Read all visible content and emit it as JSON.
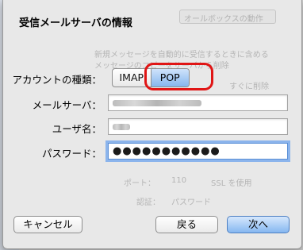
{
  "dialog": {
    "title": "受信メールサーバの情報",
    "account_type": {
      "label": "アカウントの種類：",
      "options": [
        "IMAP",
        "POP"
      ],
      "selected": "POP"
    },
    "mail_server": {
      "label": "メールサーバ："
    },
    "username": {
      "label": "ユーザ名："
    },
    "password": {
      "label": "パスワード：",
      "value": "●●●●●●●●●●●"
    },
    "buttons": {
      "cancel": "キャンセル",
      "back": "戻る",
      "next": "次へ"
    }
  },
  "background": {
    "tabs": [
      "オールボックスの動作"
    ],
    "lines": [
      "新規メッセージを自動的に受信するときに含める",
      "メッセージのコピーをサーバから削除",
      "すぐに削除"
    ],
    "port_label": "ポート：",
    "port_value": "110",
    "ssl_label": "SSL を使用",
    "auth_label": "認証：",
    "auth_value": "パスワード"
  }
}
